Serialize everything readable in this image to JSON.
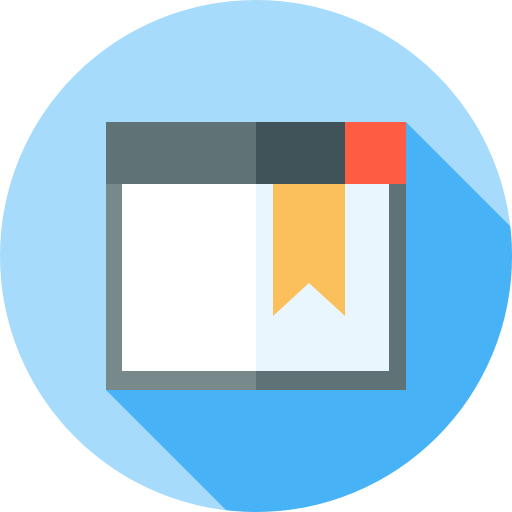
{
  "icon": {
    "name": "bookmarked-browser-window-icon",
    "colors": {
      "background_circle": "#A6DBFC",
      "long_shadow": "#48B2F6",
      "title_bar_left": "#5F7275",
      "title_bar_right": "#3F5359",
      "close_button": "#FF5D43",
      "frame_left": "#78898B",
      "frame_right": "#5F7275",
      "page_left": "#FFFFFF",
      "page_right": "#EAF6FD",
      "bookmark": "#FBBF5C"
    }
  }
}
